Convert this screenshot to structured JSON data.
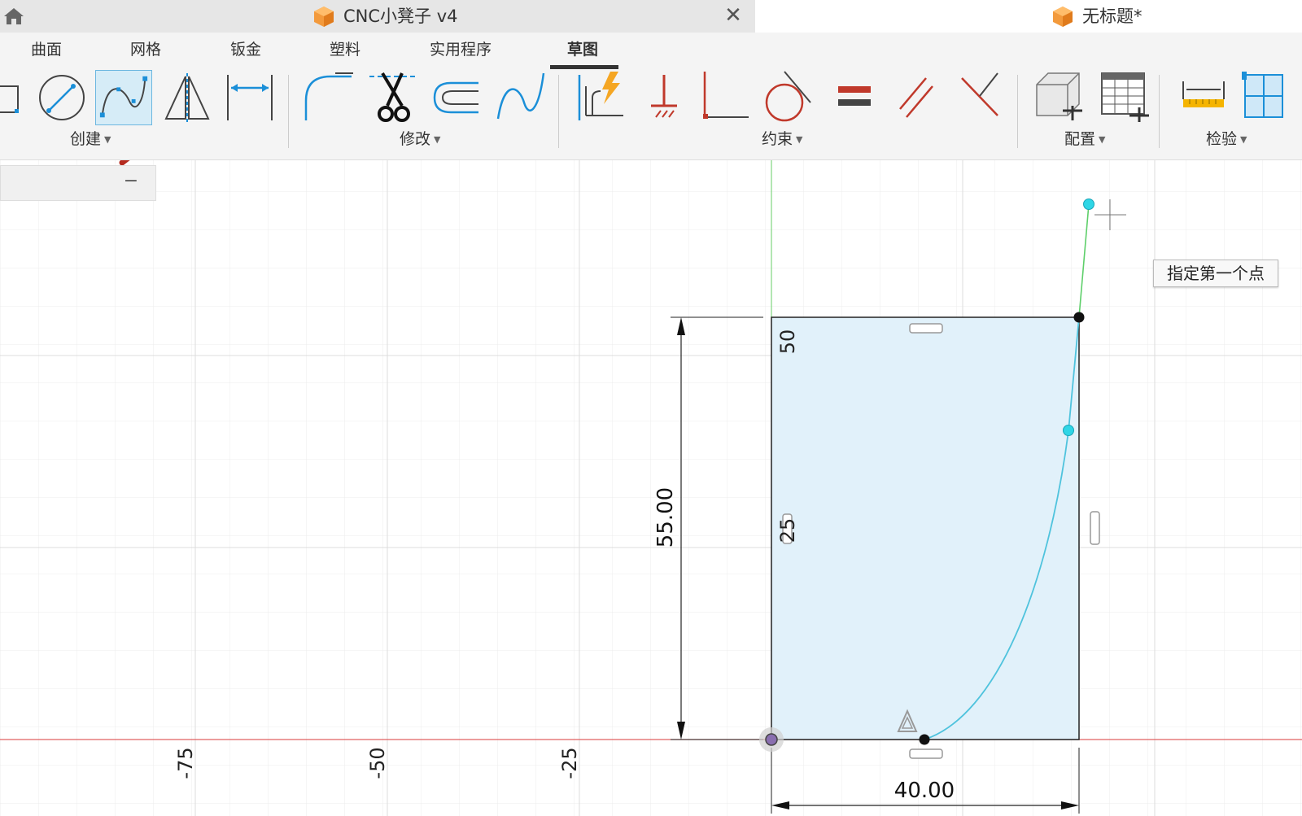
{
  "window": {
    "active_tab_title": "CNC小凳子 v4",
    "inactive_tab_title": "无标题*"
  },
  "menu_tabs": [
    "曲面",
    "网格",
    "钣金",
    "塑料",
    "实用程序",
    "草图"
  ],
  "selected_menu_tab": "草图",
  "tool_groups": {
    "create": "创建",
    "modify": "修改",
    "constraints": "约束",
    "configure": "配置",
    "inspect": "检验"
  },
  "active_tool": "spline-tool",
  "sketch": {
    "tooltip": "指定第一个点",
    "dimension_width": "40.00",
    "dimension_height": "55.00",
    "axis_labels_x": [
      "-75",
      "-50",
      "-25"
    ],
    "axis_labels_y": [
      "50",
      "25"
    ]
  },
  "colors": {
    "profile_fill": "#e1f1fa",
    "spline": "#4fc3dd",
    "control_point": "#2fd6e6",
    "x_axis": "#e06060",
    "y_axis": "#7fd67f",
    "annotation_red": "#b52b1f",
    "accent_blue": "#1b8fd8"
  }
}
